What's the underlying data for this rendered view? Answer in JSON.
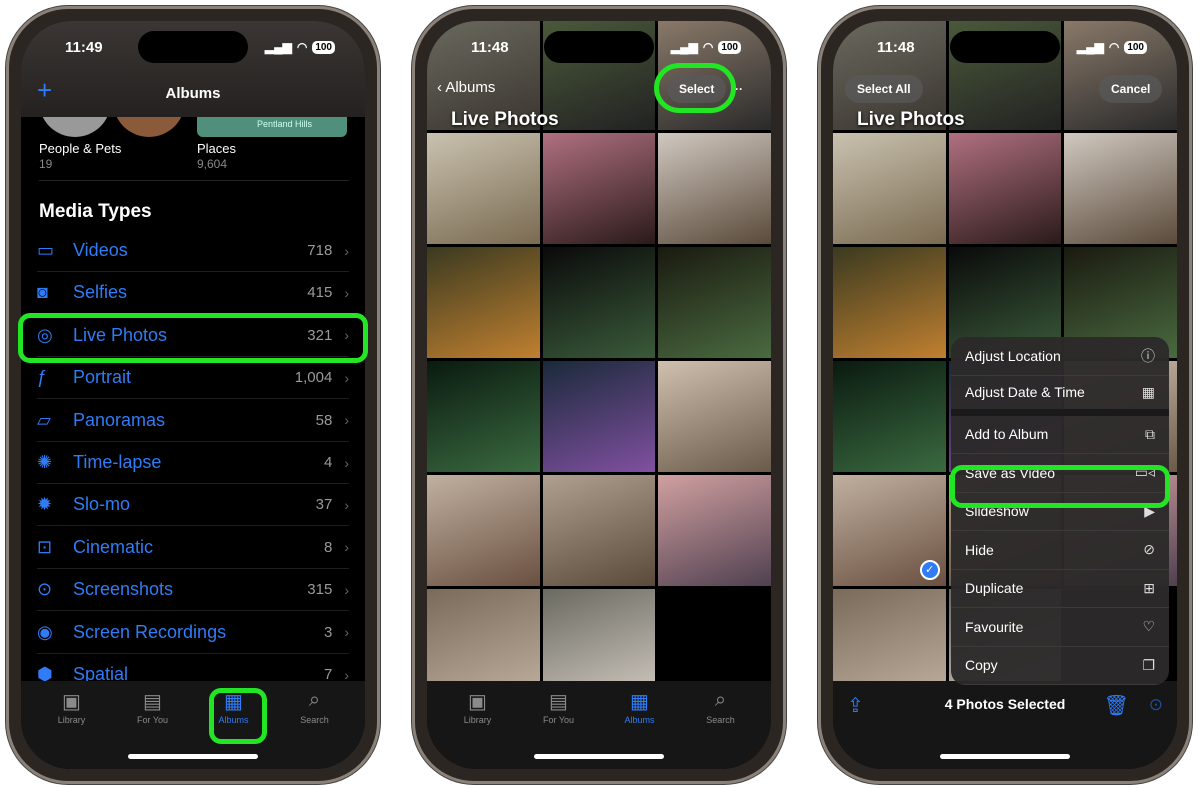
{
  "status": {
    "time": "11:49",
    "time2": "11:48",
    "battery": "100"
  },
  "p1": {
    "title": "Albums",
    "people": {
      "label": "People & Pets",
      "count": "19"
    },
    "places": {
      "label": "Places",
      "count": "9,604",
      "map_label": "Pentland Hills"
    },
    "section": "Media Types",
    "items": [
      {
        "icon": "video-icon",
        "glyph": "▭",
        "label": "Videos",
        "count": "718"
      },
      {
        "icon": "selfie-icon",
        "glyph": "◙",
        "label": "Selfies",
        "count": "415"
      },
      {
        "icon": "live-photo-icon",
        "glyph": "◎",
        "label": "Live Photos",
        "count": "321"
      },
      {
        "icon": "portrait-icon",
        "glyph": "ƒ",
        "label": "Portrait",
        "count": "1,004"
      },
      {
        "icon": "panorama-icon",
        "glyph": "▱",
        "label": "Panoramas",
        "count": "58"
      },
      {
        "icon": "timelapse-icon",
        "glyph": "✺",
        "label": "Time-lapse",
        "count": "4"
      },
      {
        "icon": "slomo-icon",
        "glyph": "✹",
        "label": "Slo-mo",
        "count": "37"
      },
      {
        "icon": "cinematic-icon",
        "glyph": "⊡",
        "label": "Cinematic",
        "count": "8"
      },
      {
        "icon": "screenshot-icon",
        "glyph": "⊙",
        "label": "Screenshots",
        "count": "315"
      },
      {
        "icon": "screen-recording-icon",
        "glyph": "◉",
        "label": "Screen Recordings",
        "count": "3"
      },
      {
        "icon": "spatial-icon",
        "glyph": "⬢",
        "label": "Spatial",
        "count": "7"
      }
    ]
  },
  "tabs": [
    {
      "icon": "library-icon",
      "glyph": "▣",
      "label": "Library"
    },
    {
      "icon": "for-you-icon",
      "glyph": "▤",
      "label": "For You"
    },
    {
      "icon": "albums-icon",
      "glyph": "▦",
      "label": "Albums"
    },
    {
      "icon": "search-icon",
      "glyph": "⌕",
      "label": "Search"
    }
  ],
  "p2": {
    "back": "Albums",
    "select": "Select",
    "more": "···",
    "title": "Live Photos"
  },
  "p3": {
    "select_all": "Select All",
    "cancel": "Cancel",
    "title": "Live Photos",
    "selected": "4 Photos Selected",
    "menu": [
      {
        "label": "Adjust Location",
        "icon": "location-info-icon",
        "glyph": "ⓘ"
      },
      {
        "label": "Adjust Date & Time",
        "icon": "calendar-icon",
        "glyph": "▦"
      },
      {
        "label": "Add to Album",
        "icon": "add-album-icon",
        "glyph": "⧉"
      },
      {
        "label": "Save as Video",
        "icon": "video-icon",
        "glyph": "▭◃"
      },
      {
        "label": "Slideshow",
        "icon": "play-icon",
        "glyph": "▶"
      },
      {
        "label": "Hide",
        "icon": "eye-slash-icon",
        "glyph": "⊘"
      },
      {
        "label": "Duplicate",
        "icon": "duplicate-icon",
        "glyph": "⊞"
      },
      {
        "label": "Favourite",
        "icon": "heart-icon",
        "glyph": "♡"
      },
      {
        "label": "Copy",
        "icon": "copy-icon",
        "glyph": "❐"
      }
    ]
  },
  "colors": {
    "accent": "#2f7cf6",
    "highlight": "#22e523"
  }
}
